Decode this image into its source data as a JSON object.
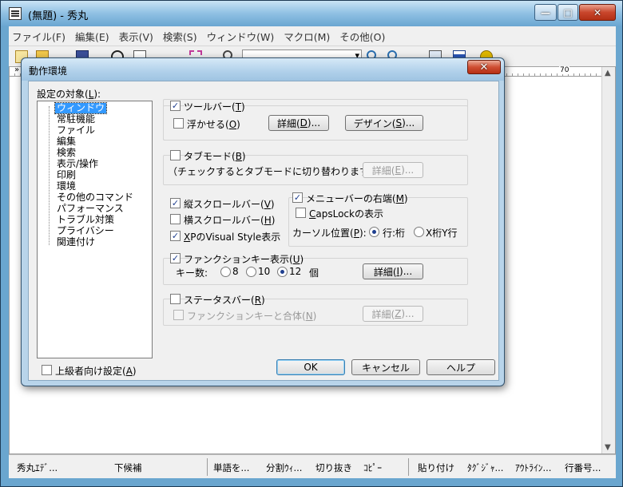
{
  "window": {
    "title": "(無題) - 秀丸",
    "min_glyph": "—",
    "max_glyph": "□",
    "close_glyph": "✕"
  },
  "menu": [
    "ファイル(F)",
    "編集(E)",
    "表示(V)",
    "検索(S)",
    "ウィンドウ(W)",
    "マクロ(M)",
    "その他(O)"
  ],
  "ruler": {
    "chevron": "»",
    "mark": "70"
  },
  "statusbar": [
    "秀丸ｴﾃﾞ...",
    "下候補",
    "単語を...",
    "分割ｳｨ...",
    "切り抜き",
    "ｺﾋﾟｰ",
    "貼り付け",
    "ﾀｸﾞｼﾞｬ...",
    "ｱｳﾄﾗｲﾝ...",
    "行番号..."
  ],
  "dialog": {
    "title": "動作環境",
    "close_glyph": "✕",
    "target_label": "設定の対象(",
    "target_key": "L",
    "target_suffix": "):",
    "tree": [
      "ウィンドウ",
      "常駐機能",
      "ファイル",
      "編集",
      "検索",
      "表示/操作",
      "印刷",
      "環境",
      "その他のコマンド",
      "パフォーマンス",
      "トラブル対策",
      "プライバシー",
      "関連付け"
    ],
    "advanced": {
      "prefix": "上級者向け設定(",
      "key": "A",
      "suffix": ")"
    },
    "toolbar_opt": {
      "prefix": "ツールバー(",
      "key": "T",
      "suffix": ")"
    },
    "float_opt": {
      "prefix": "浮かせる(",
      "key": "O",
      "suffix": ")"
    },
    "detail1": {
      "prefix": "詳細(",
      "key": "D",
      "suffix": ")..."
    },
    "design": {
      "prefix": "デザイン(",
      "key": "S",
      "suffix": ")..."
    },
    "tabmode": {
      "prefix": "タブモード(",
      "key": "B",
      "suffix": ")"
    },
    "tabmode_note": "（チェックするとタブモードに切り替わります）",
    "detail2": {
      "prefix": "詳細(",
      "key": "E",
      "suffix": ")..."
    },
    "vscroll": {
      "prefix": "縦スクロールバー(",
      "key": "V",
      "suffix": ")"
    },
    "hscroll": {
      "prefix": "横スクロールバー(",
      "key": "H",
      "suffix": ")"
    },
    "xpstyle": {
      "key": "X",
      "rest": "PのVisual Style表示"
    },
    "menubar_right": {
      "prefix": "メニューバーの右端(",
      "key": "M",
      "suffix": ")"
    },
    "capslock": {
      "key": "C",
      "rest": "apsLockの表示"
    },
    "cursor_pos": {
      "prefix": "カーソル位置(",
      "key": "P",
      "suffix": "):"
    },
    "row_col": "行:桁",
    "x_col": "X桁Y行",
    "fkey": {
      "prefix": "ファンクションキー表示(",
      "key": "U",
      "suffix": ")"
    },
    "key_count_label": "キー数:",
    "key_opts": [
      "8",
      "10",
      "12"
    ],
    "key_unit": "個",
    "detail3": {
      "prefix": "詳細(",
      "key": "I",
      "suffix": ")..."
    },
    "statusbar_opt": {
      "prefix": "ステータスバー(",
      "key": "R",
      "suffix": ")"
    },
    "combine": {
      "prefix": "ファンクションキーと合体(",
      "key": "N",
      "suffix": ")"
    },
    "detail4": {
      "prefix": "詳細(",
      "key": "Z",
      "suffix": ")..."
    },
    "ok": "OK",
    "cancel": "キャンセル",
    "help": "ヘルプ",
    "check": "✓"
  },
  "colors": {
    "selection": "#3399ff",
    "check": "#1f3f8f"
  }
}
